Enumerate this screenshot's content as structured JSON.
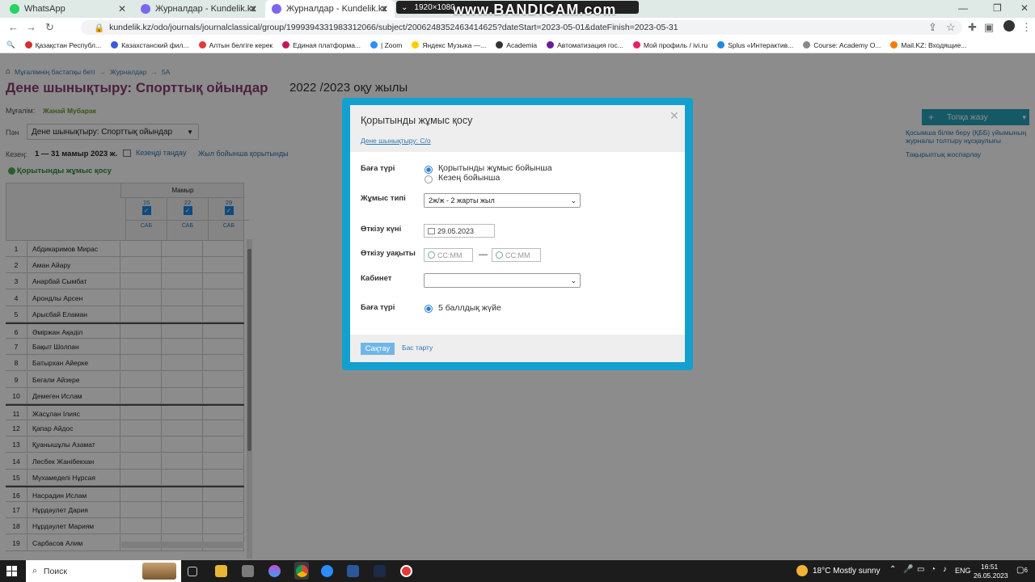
{
  "browser": {
    "tabs": [
      {
        "title": "WhatsApp",
        "color": "#25d366"
      },
      {
        "title": "Журналдар - Kundelik.kz",
        "color": "#7b68ee"
      },
      {
        "title": "Журналдар - Kundelik.kz",
        "color": "#7b68ee"
      }
    ],
    "recording_overlay": "1920×1080",
    "watermark": "www.BANDICAM.com",
    "url": "kundelik.kz/odo/journals/journalclassical/group/1999394331983312066/subject/2006248352463414625?dateStart=2023-05-01&dateFinish=2023-05-31",
    "bookmarks": [
      {
        "label": "Қазақстан Республ...",
        "color": "#d32f2f"
      },
      {
        "label": "Казахстанский фил...",
        "color": "#3b5bdb"
      },
      {
        "label": "Алтын белгіге керек",
        "color": "#e53935"
      },
      {
        "label": "Единая платформа...",
        "color": "#c2185b"
      },
      {
        "label": "| Zoom",
        "color": "#2d8cff"
      },
      {
        "label": "Яндекс Музыка —...",
        "color": "#ffcc00"
      },
      {
        "label": "Academia",
        "color": "#333333"
      },
      {
        "label": "Автоматизация гос...",
        "color": "#6a1b9a"
      },
      {
        "label": "Мой профиль / ivi.ru",
        "color": "#e91e63"
      },
      {
        "label": "Splus «Интерактив...",
        "color": "#1e88e5"
      },
      {
        "label": "Course: Academy O...",
        "color": "#888888"
      },
      {
        "label": "Mail.KZ: Входящие...",
        "color": "#f57c00"
      }
    ],
    "minimize": "—",
    "restore": "❐",
    "close": "✕"
  },
  "page": {
    "breadcrumbs": [
      "Мұғалімнің бастапқы беті",
      "Журналдар",
      "5А"
    ],
    "title": "Дене шынықтыру: Спорттық ойындар",
    "year": "2022 /2023 оқу жылы",
    "teacher_label": "Мұғалім:",
    "teacher_name": "Жанай Мубарак",
    "subject_label": "Пән",
    "subject_value": "Дене шынықтыру: Спорттық ойындар",
    "period_label": "Кезең:",
    "period_value": "1 — 31 мамыр 2023 ж.",
    "choose_period": "Кезеңді таңдау",
    "year_total": "Жыл бойынша қорытынды",
    "add_summary": "Қорытынды жұмыс қосу",
    "add_topic_btn": "Топқа жазу",
    "side_links": [
      "Қосымша білім беру (ҚББ) үйымының журналы толтыру нұсқаулығы",
      "Тақырыптық жоспарлау"
    ],
    "month": "Мамыр",
    "dates": [
      "15",
      "22",
      "29"
    ],
    "day_label": "САБ",
    "students": [
      {
        "n": "1",
        "name": "Абдикаримов Мирас"
      },
      {
        "n": "2",
        "name": "Аман Айару"
      },
      {
        "n": "3",
        "name": "Анарбай Сымбат"
      },
      {
        "n": "4",
        "name": "Арондлы Арсен"
      },
      {
        "n": "5",
        "name": "Арысбай Еламан"
      },
      {
        "n": "6",
        "name": "Әміржан Ақәділ"
      },
      {
        "n": "7",
        "name": "Бақыт Шолпан"
      },
      {
        "n": "8",
        "name": "Батырхан Айерке"
      },
      {
        "n": "9",
        "name": "Бегали Айзере"
      },
      {
        "n": "10",
        "name": "Демеген Ислам"
      },
      {
        "n": "11",
        "name": "Жасұлан Ілияс"
      },
      {
        "n": "12",
        "name": "Қапар Айдос"
      },
      {
        "n": "13",
        "name": "Қуанышұлы Азамат"
      },
      {
        "n": "14",
        "name": "Лесбек Жанібекхан"
      },
      {
        "n": "15",
        "name": "Мухамеделі Нұрсая"
      },
      {
        "n": "16",
        "name": "Насрадин Ислам"
      },
      {
        "n": "17",
        "name": "Нұрдәулет Дария"
      },
      {
        "n": "18",
        "name": "Нұрдәулет Мариям"
      },
      {
        "n": "19",
        "name": "Сарбасов Алим"
      }
    ]
  },
  "modal": {
    "title": "Қорытынды жұмыс қосу",
    "subtitle_link": "Дене шынықтыру: С/о",
    "grade_type_label": "Баға түрі",
    "grade_type_options": [
      "Қорытынды жұмыс бойынша",
      "Кезең бойынша"
    ],
    "grade_type_selected": 0,
    "work_type_label": "Жұмыс типі",
    "work_type_value": "2ж/ж - 2 жарты жыл",
    "date_label": "Өткізу күні",
    "date_value": "29.05.2023",
    "time_label": "Өткізу уақыты",
    "time_placeholder_from": "СС:ММ",
    "time_placeholder_to": "СС:ММ",
    "time_dash": "—",
    "room_label": "Кабинет",
    "room_value": "",
    "scale_label": "Баға түрі",
    "scale_value": "5 баллдық жүйе",
    "save": "Сақтау",
    "cancel": "Бас тарту",
    "close": "✕"
  },
  "taskbar": {
    "search": "Поиск",
    "weather": "18°C  Mostly sunny",
    "lang": "ENG",
    "time": "16:51",
    "date": "26.05.2023",
    "notifications": "6"
  }
}
